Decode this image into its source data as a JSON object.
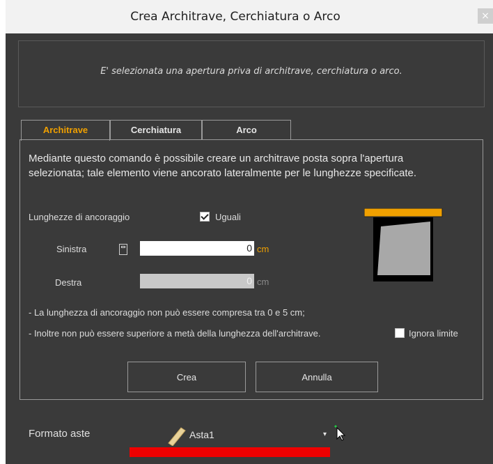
{
  "window": {
    "title": "Crea Architrave, Cerchiatura o Arco",
    "close_glyph": "×"
  },
  "info": {
    "text": "E' selezionata una apertura priva di architrave, cerchiatura o arco."
  },
  "tabs": [
    {
      "label": "Architrave",
      "active": true
    },
    {
      "label": "Cerchiatura",
      "active": false
    },
    {
      "label": "Arco",
      "active": false
    }
  ],
  "panel": {
    "description": "Mediante questo comando è possibile creare un architrave posta sopra l'apertura selezionata; tale elemento viene ancorato lateralmente per le lunghezze specificate.",
    "anchor_label": "Lunghezze di ancoraggio",
    "equal_label": "Uguali",
    "equal_checked": true,
    "left_label": "Sinistra",
    "left_value": "0",
    "left_unit": "cm",
    "right_label": "Destra",
    "right_value": "0",
    "right_unit": "cm",
    "note1": "- La lunghezza di ancoraggio non può essere compresa tra 0 e 5 cm;",
    "note2": "- Inoltre non può essere superiore a metà della lunghezza dell'architrave.",
    "ignore_label": "Ignora limite",
    "ignore_checked": false,
    "create_label": "Crea",
    "cancel_label": "Annulla"
  },
  "footer": {
    "format_label": "Formato aste",
    "selected": "Asta1",
    "dropdown_glyph": "▾"
  },
  "colors": {
    "accent": "#f0a000",
    "background": "#3a3a3a",
    "highlight": "#ee0000"
  }
}
